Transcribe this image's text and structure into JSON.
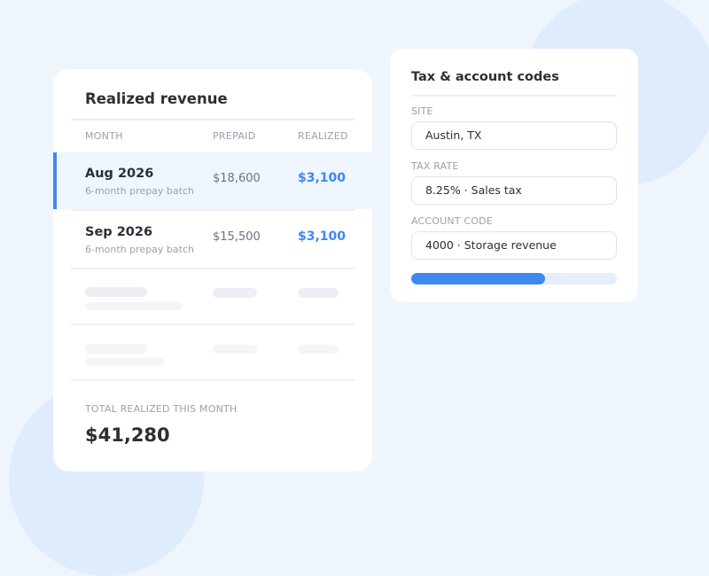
{
  "revenue": {
    "title": "Realized revenue",
    "columns": {
      "month": "MONTH",
      "prepaid": "PREPAID",
      "realized": "REALIZED"
    },
    "rows": [
      {
        "month": "Aug 2026",
        "subtitle": "6-month prepay batch",
        "prepaid": "$18,600",
        "realized": "$3,100",
        "selected": true
      },
      {
        "month": "Sep 2026",
        "subtitle": "6-month prepay batch",
        "prepaid": "$15,500",
        "realized": "$3,100",
        "selected": false
      }
    ],
    "total_label": "TOTAL REALIZED THIS MONTH",
    "total_value": "$41,280"
  },
  "tax": {
    "title": "Tax & account codes",
    "fields": [
      {
        "label": "SITE",
        "value": "Austin, TX"
      },
      {
        "label": "TAX RATE",
        "value": "8.25% · Sales tax"
      },
      {
        "label": "ACCOUNT CODE",
        "value": "4000 · Storage revenue"
      }
    ],
    "progress_percent": 65
  },
  "colors": {
    "accent": "#3f88f0",
    "background": "#eef5fd",
    "selected_row": "#eff6fe"
  }
}
